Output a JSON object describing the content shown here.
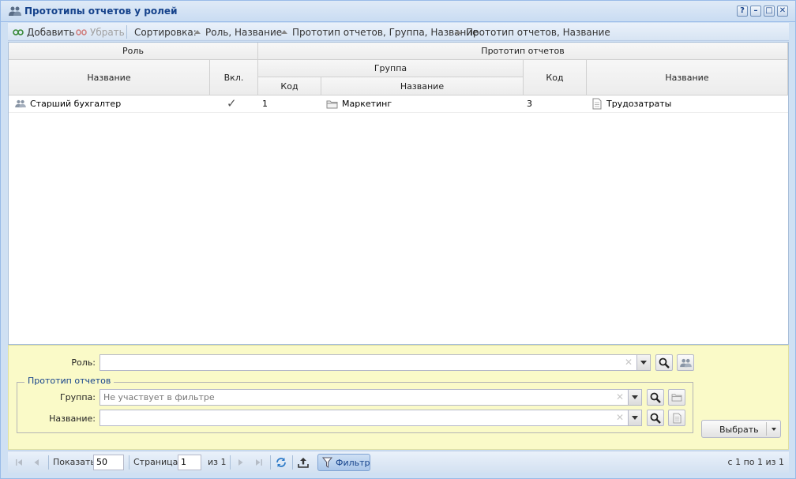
{
  "window": {
    "title": "Прототипы отчетов у ролей",
    "buttons": [
      "?",
      "–",
      "□",
      "✕"
    ]
  },
  "toolbar": {
    "add_label": "Добавить",
    "remove_label": "Убрать",
    "sort_label": "Сортировка:",
    "sort_items": [
      "Роль, Название",
      "Прототип отчетов, Группа, Название",
      "Прототип отчетов, Название"
    ]
  },
  "grid": {
    "group_headers": {
      "role": "Роль",
      "prototype": "Прототип отчетов",
      "group": "Группа"
    },
    "columns": {
      "role_name": "Название",
      "enabled": "Вкл.",
      "group_code": "Код",
      "group_name": "Название",
      "proto_code": "Код",
      "proto_name": "Название"
    },
    "rows": [
      {
        "role_name": "Старший бухгалтер",
        "enabled": "✓",
        "group_code": "1",
        "group_name": "Маркетинг",
        "proto_code": "3",
        "proto_name": "Трудозатраты"
      }
    ]
  },
  "filter": {
    "role_label": "Роль:",
    "role_value": "",
    "fieldset_legend": "Прототип отчетов",
    "group_label": "Группа:",
    "group_placeholder": "Не участвует в фильтре",
    "name_label": "Название:",
    "name_value": "",
    "choose_button": "Выбрать"
  },
  "paging": {
    "show_label": "Показать",
    "page_size": "50",
    "page_label": "Страница",
    "page_value": "1",
    "of_label": "из 1",
    "filter_button": "Фильтр",
    "summary": "с 1 по 1 из 1"
  }
}
